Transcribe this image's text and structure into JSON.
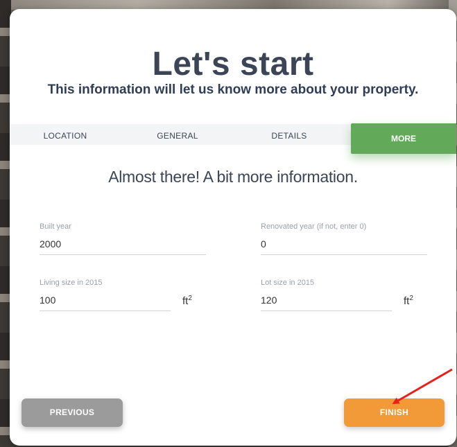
{
  "page": {
    "title": "Let's start",
    "subtitle": "This information will let us know more about your property."
  },
  "steps": [
    {
      "label": "LOCATION"
    },
    {
      "label": "GENERAL"
    },
    {
      "label": "DETAILS"
    },
    {
      "label": "MORE",
      "active": true
    }
  ],
  "section_heading": "Almost there! A bit more information.",
  "form": {
    "built_year": {
      "label": "Built year",
      "value": "2000"
    },
    "renovated_year": {
      "label": "Renovated year (if not, enter 0)",
      "value": "0"
    },
    "living_size": {
      "label": "Living size in 2015",
      "value": "100",
      "unit": "ft",
      "unit_exp": "2"
    },
    "lot_size": {
      "label": "Lot size in 2015",
      "value": "120",
      "unit": "ft",
      "unit_exp": "2"
    }
  },
  "buttons": {
    "previous": "PREVIOUS",
    "finish": "FINISH"
  },
  "colors": {
    "active_step": "#62a95a",
    "finish_button": "#f39a38",
    "previous_button": "#9b9b9b",
    "annotation_arrow": "#e8201a"
  }
}
